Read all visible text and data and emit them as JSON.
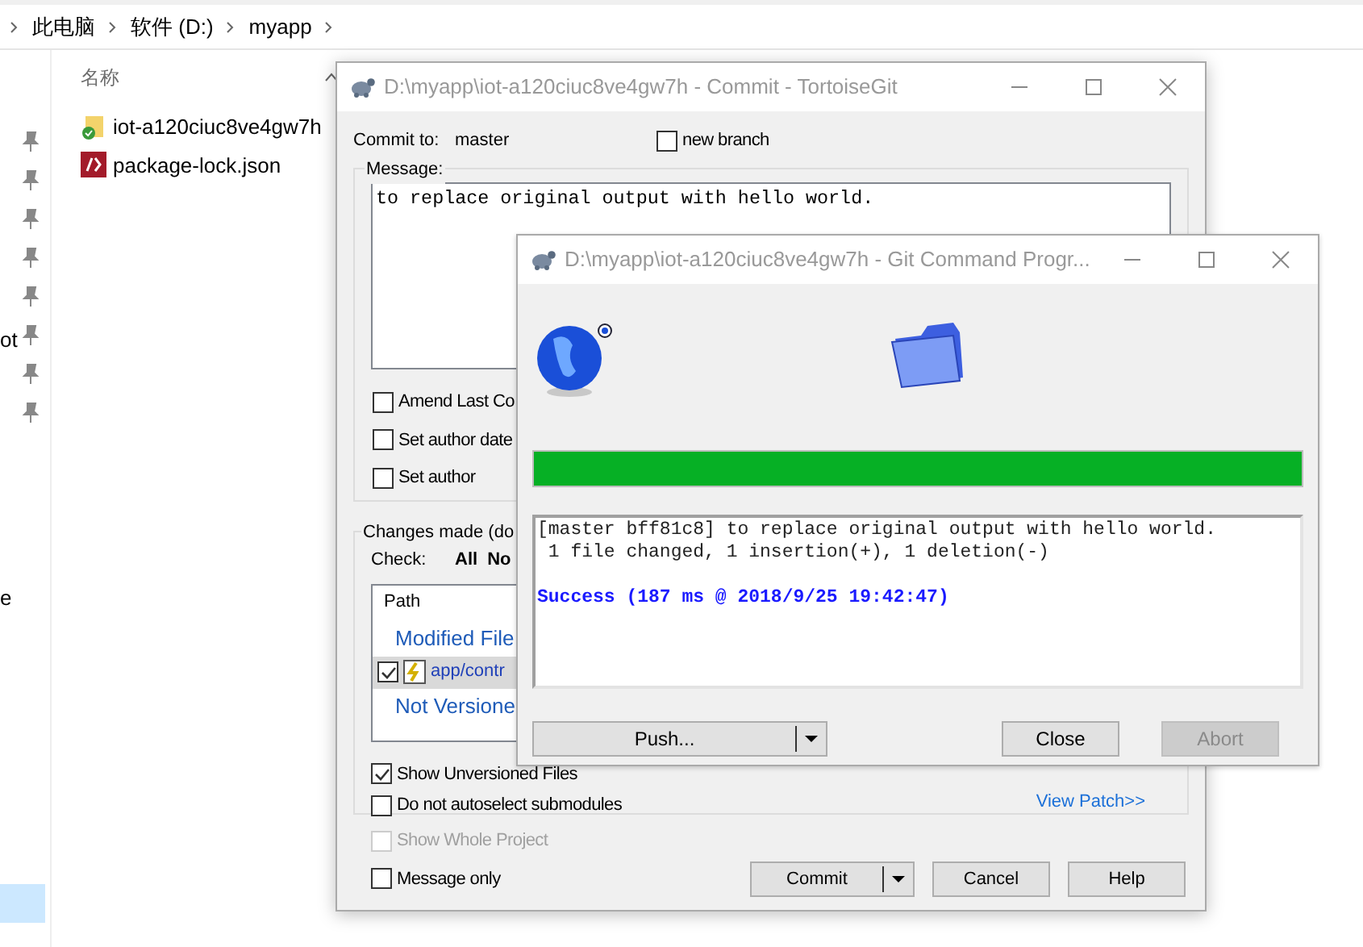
{
  "explorer": {
    "breadcrumb": [
      "此电脑",
      "软件 (D:)",
      "myapp"
    ],
    "column_header": "名称",
    "files": [
      {
        "name": "iot-a120ciuc8ve4gw7h",
        "kind": "folder"
      },
      {
        "name": "package-lock.json",
        "kind": "json"
      }
    ],
    "nav_fragments": [
      "ot",
      "e"
    ]
  },
  "commit_window": {
    "title": "D:\\myapp\\iot-a120ciuc8ve4gw7h - Commit - TortoiseGit",
    "commit_to_label": "Commit to:",
    "branch": "master",
    "new_branch": {
      "label": "new branch",
      "checked": false
    },
    "message_label": "Message:",
    "message": "to replace original output with hello world.",
    "message_options": [
      {
        "label": "Amend Last Co",
        "checked": false
      },
      {
        "label": "Set author date",
        "checked": false
      },
      {
        "label": "Set author",
        "checked": false
      }
    ],
    "changes_label": "Changes made (do",
    "check_label": "Check:",
    "check_links": [
      "All",
      "No"
    ],
    "file_list": {
      "column": "Path",
      "groups": [
        {
          "label": "Modified File",
          "files": [
            {
              "name": "app/contr",
              "checked": true,
              "selected": true
            }
          ]
        },
        {
          "label": "Not Versione"
        }
      ]
    },
    "list_options": [
      {
        "label": "Show Unversioned Files",
        "checked": true
      },
      {
        "label": "Do not autoselect submodules",
        "checked": false
      }
    ],
    "view_patch": "View Patch>>",
    "footer_options": [
      {
        "label": "Show Whole Project",
        "checked": false,
        "disabled": true
      },
      {
        "label": "Message only",
        "checked": false,
        "disabled": false
      }
    ],
    "buttons": [
      {
        "label": "Commit",
        "kind": "split"
      },
      {
        "label": "Cancel",
        "kind": "plain"
      },
      {
        "label": "Help",
        "kind": "plain"
      }
    ]
  },
  "progress_window": {
    "title": "D:\\myapp\\iot-a120ciuc8ve4gw7h - Git Command Progr...",
    "progress": {
      "level": 1
    },
    "output": [
      {
        "text": "[master bff81c8] to replace original output with hello world.",
        "kind": "plain"
      },
      {
        "text": " 1 file changed, 1 insertion(+), 1 deletion(-)",
        "kind": "plain"
      },
      {
        "kind": "blank"
      },
      {
        "text": "Success (187 ms @ 2018/9/25 19:42:47)",
        "kind": "success"
      }
    ],
    "buttons": [
      {
        "label": "Push...",
        "kind": "split",
        "disabled": false
      },
      {
        "label": "Close",
        "kind": "plain",
        "disabled": false
      },
      {
        "label": "Abort",
        "kind": "plain",
        "disabled": true
      }
    ]
  }
}
